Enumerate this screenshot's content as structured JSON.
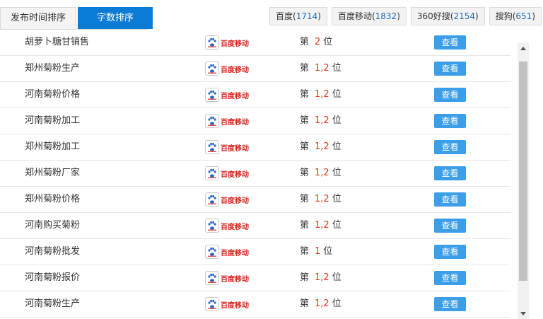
{
  "tabs": [
    {
      "label": "发布时间排序",
      "active": false
    },
    {
      "label": "字数排序",
      "active": true
    }
  ],
  "engines": [
    {
      "name": "百度",
      "count": "1714"
    },
    {
      "name": "百度移动",
      "count": "1832"
    },
    {
      "name": "360好搜",
      "count": "2154"
    },
    {
      "name": "搜狗",
      "count": "651"
    }
  ],
  "source_label": "百度移动",
  "rank_prefix": "第",
  "rank_suffix": "位",
  "view_label": "查看",
  "rows": [
    {
      "keyword": "胡萝卜糖甘销售",
      "rank": "2"
    },
    {
      "keyword": "郑州菊粉生产",
      "rank": "1,2"
    },
    {
      "keyword": "河南菊粉价格",
      "rank": "1,2"
    },
    {
      "keyword": "河南菊粉加工",
      "rank": "1,2"
    },
    {
      "keyword": "郑州菊粉加工",
      "rank": "1,2"
    },
    {
      "keyword": "郑州菊粉厂家",
      "rank": "1,2"
    },
    {
      "keyword": "郑州菊粉价格",
      "rank": "1,2"
    },
    {
      "keyword": "河南购买菊粉",
      "rank": "1,2"
    },
    {
      "keyword": "河南菊粉批发",
      "rank": "1"
    },
    {
      "keyword": "河南菊粉报价",
      "rank": "1,2"
    },
    {
      "keyword": "河南菊粉生产",
      "rank": "1,2"
    }
  ]
}
